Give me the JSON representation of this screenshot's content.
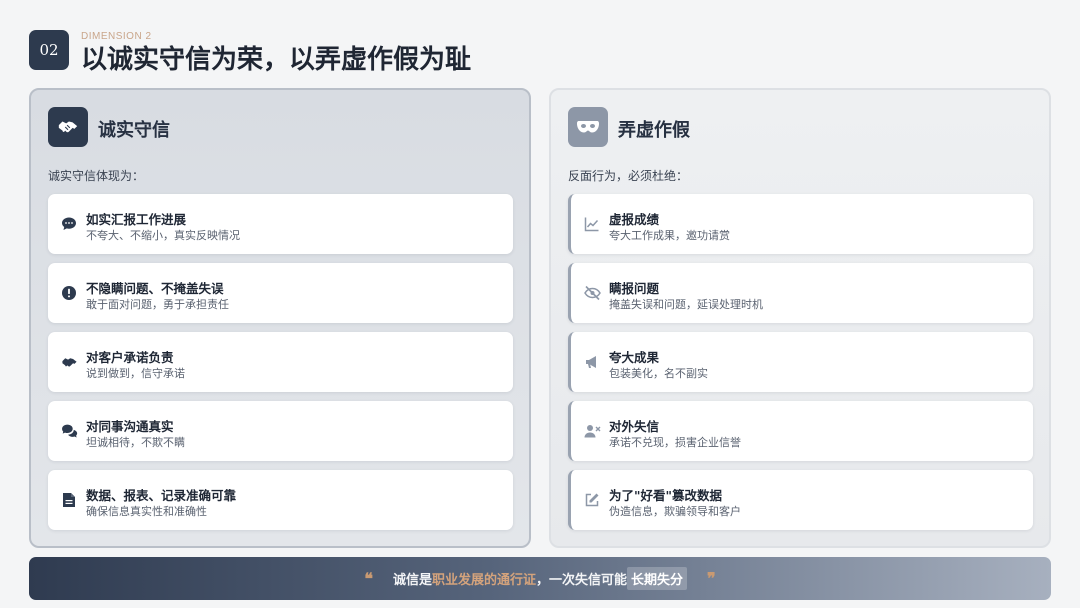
{
  "header": {
    "number": "02",
    "dimension_label": "DIMENSION 2",
    "title": "以诚实守信为荣，以弄虚作假为耻"
  },
  "left_panel": {
    "icon": "handshake-icon",
    "title": "诚实守信",
    "subtitle": "诚实守信体现为：",
    "items": [
      {
        "icon": "chat-icon",
        "title": "如实汇报工作进展",
        "desc": "不夸大、不缩小，真实反映情况"
      },
      {
        "icon": "alert-icon",
        "title": "不隐瞒问题、不掩盖失误",
        "desc": "敢于面对问题，勇于承担责任"
      },
      {
        "icon": "handshake-icon",
        "title": "对客户承诺负责",
        "desc": "说到做到，信守承诺"
      },
      {
        "icon": "conversation-icon",
        "title": "对同事沟通真实",
        "desc": "坦诚相待，不欺不瞒"
      },
      {
        "icon": "document-icon",
        "title": "数据、报表、记录准确可靠",
        "desc": "确保信息真实性和准确性"
      }
    ]
  },
  "right_panel": {
    "icon": "mask-icon",
    "title": "弄虚作假",
    "subtitle": "反面行为，必须杜绝：",
    "items": [
      {
        "icon": "chart-line-icon",
        "title": "虚报成绩",
        "desc": "夸大工作成果，邀功请赏"
      },
      {
        "icon": "eye-slash-icon",
        "title": "瞒报问题",
        "desc": "掩盖失误和问题，延误处理时机"
      },
      {
        "icon": "megaphone-icon",
        "title": "夸大成果",
        "desc": "包装美化，名不副实"
      },
      {
        "icon": "user-x-icon",
        "title": "对外失信",
        "desc": "承诺不兑现，损害企业信誉"
      },
      {
        "icon": "edit-icon",
        "title": "为了\"好看\"篡改数据",
        "desc": "伪造信息，欺骗领导和客户"
      }
    ]
  },
  "footer": {
    "quote_open": "❝",
    "part1": "诚信是",
    "part2": "职业发展的通行证",
    "part3": "，一次失信可能",
    "part4": "长期失分",
    "quote_close": "❞"
  },
  "colors": {
    "primary": "#2d3a4e",
    "accent": "#c99a72",
    "muted": "#8d97a7"
  }
}
